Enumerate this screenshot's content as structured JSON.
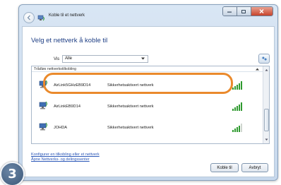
{
  "window": {
    "title": "Koble til et nettverk",
    "heading": "Velg et nettverk å koble til"
  },
  "filter": {
    "label": "Vis",
    "selected": "Alle"
  },
  "list": {
    "group_header": "Trådløs nettverkstilkobling",
    "networks": [
      {
        "ssid": "AirLink5GHzEB9D14",
        "security": "Sikkerhetsaktivert nettverk",
        "signal_bars": 5,
        "selected": true
      },
      {
        "ssid": "AirLinkEB9D14",
        "security": "Sikkerhetsaktivert nettverk",
        "signal_bars": 5,
        "selected": false
      },
      {
        "ssid": "JOHDA",
        "security": "Sikkerhetsaktivert nettverk",
        "signal_bars": 4,
        "selected": false
      }
    ]
  },
  "links": {
    "configure": "Konfigurer en tilkobling eller et nettverk",
    "network_center": "Åpne Nettverks- og delingssenter"
  },
  "buttons": {
    "connect": "Koble til",
    "cancel": "Avbryt"
  },
  "step": "3",
  "colors": {
    "highlight": "#ea8a2c",
    "heading": "#1f3f85",
    "link": "#2c58b8",
    "signal": "#2f9a2f"
  }
}
